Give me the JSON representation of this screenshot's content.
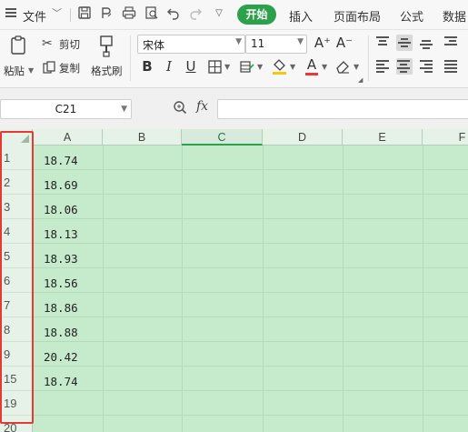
{
  "menubar": {
    "file_label": "文件",
    "tabs": [
      "开始",
      "插入",
      "页面布局",
      "公式",
      "数据"
    ]
  },
  "ribbon": {
    "paste_label": "粘贴",
    "cut_label": "剪切",
    "copy_label": "复制",
    "format_painter_label": "格式刷",
    "font_name": "宋体",
    "font_size": "11",
    "bold_label": "B",
    "italic_label": "I",
    "underline_label": "U",
    "font_color_label": "A",
    "grow_font_label": "A⁺",
    "shrink_font_label": "A⁻",
    "font_color": "#e53935",
    "fill_color": "#f2c811"
  },
  "formulabar": {
    "cell_ref": "C21",
    "fx_label": "fx",
    "formula_value": ""
  },
  "sheet": {
    "columns": [
      "A",
      "B",
      "C",
      "D",
      "E",
      "F"
    ],
    "active_column": "C",
    "rows": [
      {
        "row": "1",
        "a": "18.74"
      },
      {
        "row": "2",
        "a": "18.69"
      },
      {
        "row": "3",
        "a": "18.06"
      },
      {
        "row": "4",
        "a": "18.13"
      },
      {
        "row": "5",
        "a": "18.93"
      },
      {
        "row": "6",
        "a": "18.56"
      },
      {
        "row": "7",
        "a": "18.86"
      },
      {
        "row": "8",
        "a": "18.88"
      },
      {
        "row": "9",
        "a": "20.42"
      },
      {
        "row": "15",
        "a": "18.74"
      },
      {
        "row": "19",
        "a": ""
      },
      {
        "row": "20",
        "a": ""
      }
    ],
    "highlight_color": "#e53935",
    "grid_fill_color": "#c6ebcc"
  }
}
